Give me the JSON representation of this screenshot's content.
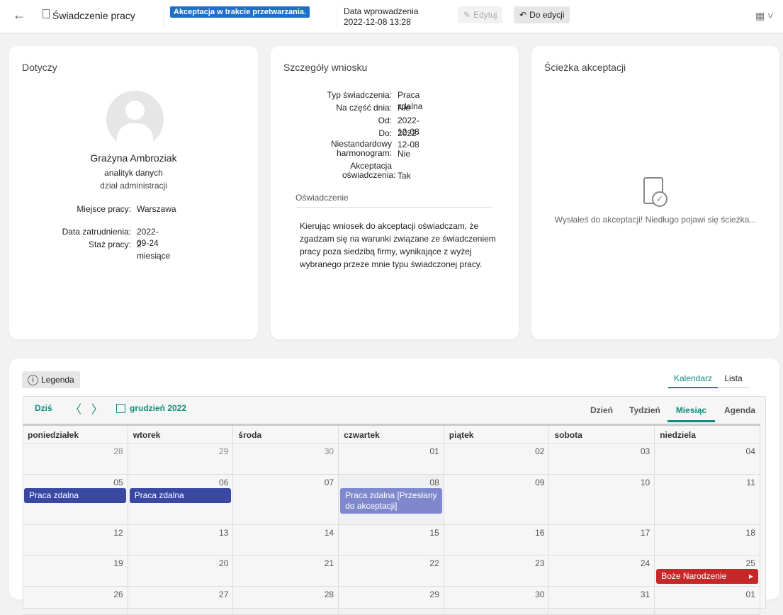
{
  "header": {
    "title": "Świadczenie pracy",
    "status": "Akceptacja w trakcie przetwarzania.",
    "date_label": "Data wprowadzenia",
    "date_value": "2022-12-08 13:28",
    "edit": "Edytuj",
    "return": "Do edycji"
  },
  "person": {
    "title": "Dotyczy",
    "name": "Grażyna Ambroziak",
    "position": "analityk danych",
    "department": "dział administracji",
    "fields": [
      {
        "k": "Miejsce pracy:",
        "v": "Warszawa"
      },
      {
        "k": "Data zatrudnienia:",
        "v": "2022-09-24"
      },
      {
        "k": "Staż pracy:",
        "v": "2 miesiące"
      }
    ]
  },
  "details": {
    "title": "Szczegóły wniosku",
    "fields": [
      {
        "k": "Typ świadczenia:",
        "v": "Praca zdalna"
      },
      {
        "k": "Na część dnia:",
        "v": "Nie"
      },
      {
        "k": "Od:",
        "v": "2022-12-08"
      },
      {
        "k": "Do:",
        "v": "2022-12-08"
      },
      {
        "k": "Niestandardowy harmonogram:",
        "v": "Nie"
      },
      {
        "k": "Akceptacja oświadczenia:",
        "v": "Tak"
      }
    ],
    "statement_title": "Oświadczenie",
    "statement": "Kierując wniosek do akceptacji oświadczam, że zgadzam się na warunki związane ze świadczeniem pracy poza siedzibą firmy, wynikające z wyżej wybranego przeze mnie typu świadczonej pracy."
  },
  "path": {
    "title": "Ścieżka akceptacji",
    "message": "Wysłałeś do akceptacji! Niedługo pojawi się ścieżka..."
  },
  "calendar": {
    "legend": "Legenda",
    "tabs": [
      "Kalendarz",
      "Lista"
    ],
    "today": "Dziś",
    "month": "grudzień 2022",
    "views": [
      "Dzień",
      "Tydzień",
      "Miesiąc",
      "Agenda"
    ],
    "days": [
      "poniedziałek",
      "wtorek",
      "środa",
      "czwartek",
      "piątek",
      "sobota",
      "niedziela"
    ],
    "weeks": [
      [
        "28",
        "29",
        "30",
        "01",
        "02",
        "03",
        "04"
      ],
      [
        "05",
        "06",
        "07",
        "08",
        "09",
        "10",
        "11"
      ],
      [
        "12",
        "13",
        "14",
        "15",
        "16",
        "17",
        "18"
      ],
      [
        "19",
        "20",
        "21",
        "22",
        "23",
        "24",
        "25"
      ],
      [
        "26",
        "27",
        "28",
        "29",
        "30",
        "31",
        "01"
      ]
    ],
    "events": [
      {
        "week": 1,
        "day": 0,
        "label": "Praca zdalna",
        "color": "#3949a3"
      },
      {
        "week": 1,
        "day": 1,
        "label": "Praca zdalna",
        "color": "#3949a3"
      },
      {
        "week": 1,
        "day": 3,
        "label": "Praca zdalna [Przesłany do akceptacji]",
        "color": "#7f88cc"
      },
      {
        "week": 3,
        "day": 6,
        "label": "Boże Narodzenie",
        "color": "#c62828"
      }
    ]
  },
  "colors": {
    "accent": "#0f8c7b"
  }
}
